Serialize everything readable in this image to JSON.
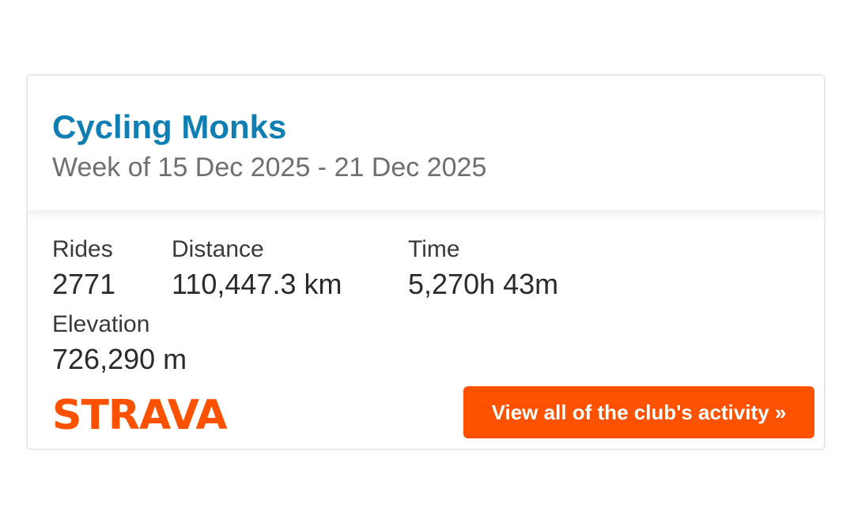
{
  "club": {
    "name": "Cycling Monks",
    "week_range": "Week of 15 Dec 2025 - 21 Dec 2025"
  },
  "stats": {
    "rides": {
      "label": "Rides",
      "value": "2771"
    },
    "distance": {
      "label": "Distance",
      "value": "110,447.3 km"
    },
    "time": {
      "label": "Time",
      "value": "5,270h 43m"
    },
    "elevation": {
      "label": "Elevation",
      "value": "726,290 m"
    }
  },
  "footer": {
    "logo_text": "STRAVA",
    "button_label": "View all of the club's activity »"
  },
  "colors": {
    "club_name": "#0f7eb3",
    "brand_orange": "#fc5200",
    "subtitle": "#6f6f6f"
  }
}
